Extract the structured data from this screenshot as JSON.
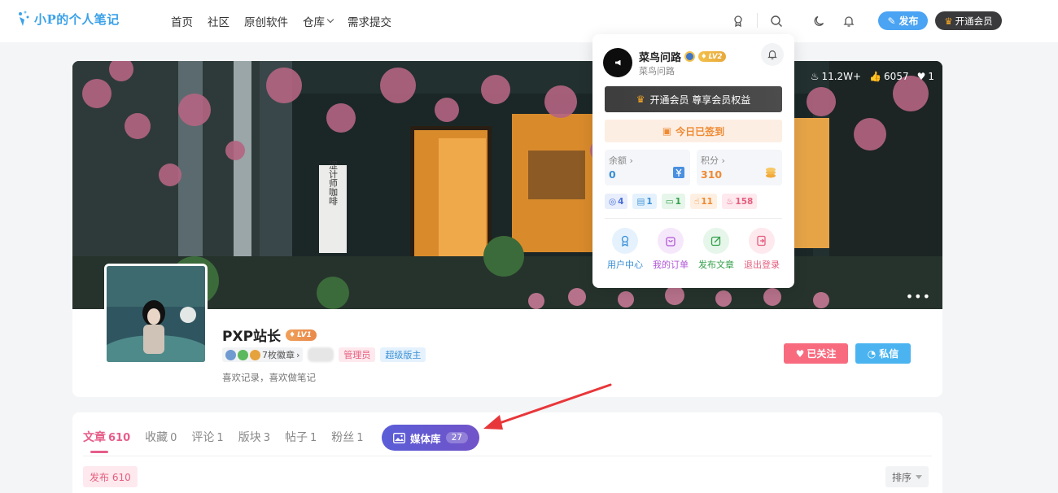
{
  "header": {
    "logo_text": "小P的个人笔记",
    "nav": [
      "首页",
      "社区",
      "原创软件",
      "仓库",
      "需求提交"
    ],
    "publish_label": "发布",
    "vip_label": "开通会员"
  },
  "cover": {
    "stats": {
      "views": "11.2W+",
      "likes": "6057",
      "favorites": "1"
    },
    "sign_text": "涩计师咖啡"
  },
  "profile": {
    "name": "PXP站长",
    "level": "LV1",
    "medals_label": "7枚徽章",
    "tags": [
      "管理员",
      "超级版主"
    ],
    "bio": "喜欢记录，喜欢做笔记",
    "follow_label": "已关注",
    "message_label": "私信"
  },
  "tabs": {
    "items": [
      {
        "label": "文章",
        "count": "610",
        "active": true
      },
      {
        "label": "收藏",
        "count": "0"
      },
      {
        "label": "评论",
        "count": "1"
      },
      {
        "label": "版块",
        "count": "3"
      },
      {
        "label": "帖子",
        "count": "1"
      },
      {
        "label": "粉丝",
        "count": "1"
      }
    ],
    "media_label": "媒体库",
    "media_count": "27",
    "publish_filter": "发布 610",
    "sort_label": "排序"
  },
  "dropdown": {
    "name": "菜鸟问路",
    "level": "LV2",
    "subtitle": "菜鸟问路",
    "vip_label": "开通会员 尊享会员权益",
    "checkin_label": "今日已签到",
    "balance_label": "余额",
    "balance_value": "0",
    "points_label": "积分",
    "points_value": "310",
    "counts": {
      "comments": "4",
      "posts": "1",
      "replies": "1",
      "likes": "11",
      "fire": "158"
    },
    "actions": [
      "用户中心",
      "我的订单",
      "发布文章",
      "退出登录"
    ]
  },
  "colors": {
    "accent_pink": "#e65e8a",
    "accent_blue": "#4aa3f3",
    "media_purple": "#6258d0",
    "arrow_red": "#e8373a"
  }
}
